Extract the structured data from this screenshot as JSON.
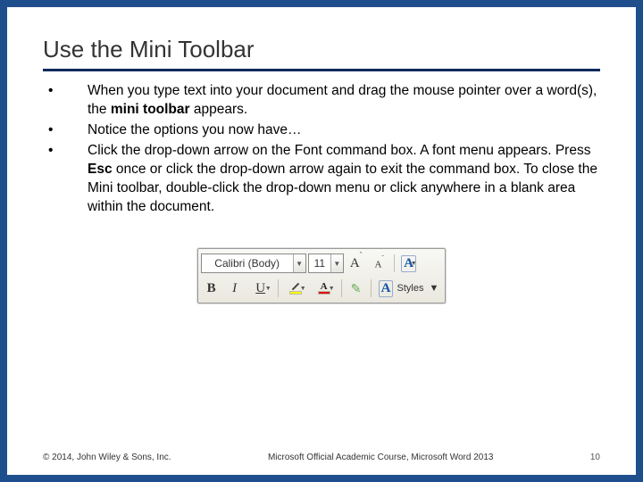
{
  "title": "Use the Mini Toolbar",
  "bullets": [
    {
      "pre": "When you type text into your document and drag the mouse pointer over a word(s), the ",
      "bold": "mini toolbar ",
      "post": "appears."
    },
    {
      "pre": "Notice the options you now have…",
      "bold": "",
      "post": ""
    },
    {
      "pre": "Click the drop-down arrow on the Font command box. A font menu appears. Press ",
      "bold": "Esc ",
      "post": "once or click the drop-down arrow again to exit the command box. To close the Mini toolbar, double-click the drop-down menu or click anywhere in a blank area within the document."
    }
  ],
  "toolbar": {
    "font_name": "Calibri (Body)",
    "font_size": "11",
    "grow_label": "A",
    "shrink_label": "A",
    "bold_label": "B",
    "italic_label": "I",
    "underline_label": "U",
    "fontcolor_letter": "A",
    "styles_label": "Styles"
  },
  "footer": {
    "copyright": "© 2014, John Wiley & Sons, Inc.",
    "center": "Microsoft Official Academic Course, Microsoft Word 2013",
    "page": "10"
  }
}
